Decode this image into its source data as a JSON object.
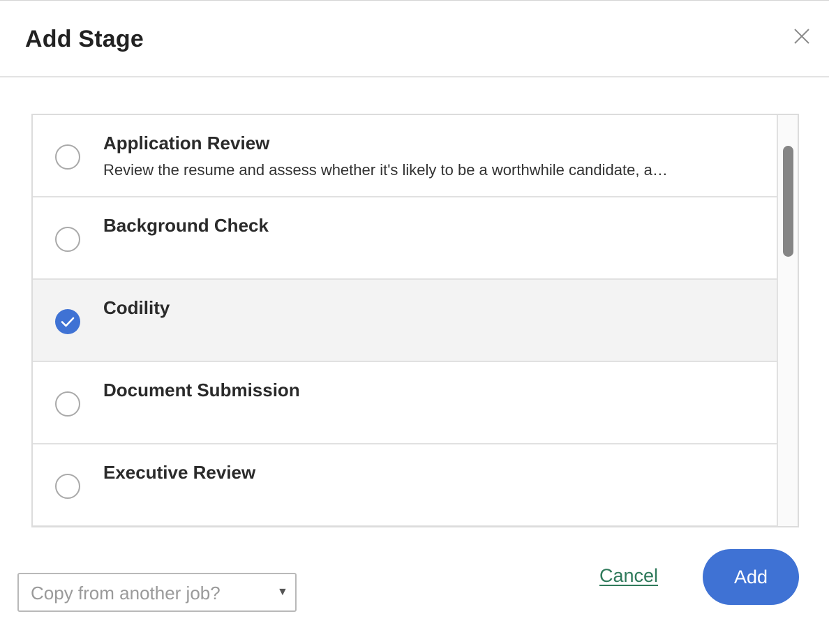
{
  "dialog": {
    "title": "Add Stage",
    "close_icon": "close-icon"
  },
  "stages": [
    {
      "name": "Application Review",
      "description": "Review the resume and assess whether it's likely to be a worthwhile candidate, a…",
      "selected": false
    },
    {
      "name": "Background Check",
      "description": "",
      "selected": false
    },
    {
      "name": "Codility",
      "description": "",
      "selected": true
    },
    {
      "name": "Document Submission",
      "description": "",
      "selected": false
    },
    {
      "name": "Executive Review",
      "description": "",
      "selected": false
    }
  ],
  "footer": {
    "copy_select_placeholder": "Copy from another job?",
    "cancel_label": "Cancel",
    "add_label": "Add"
  },
  "colors": {
    "accent": "#3f72d4",
    "link": "#2f7a5b",
    "selected_row_bg": "#f3f3f3"
  }
}
